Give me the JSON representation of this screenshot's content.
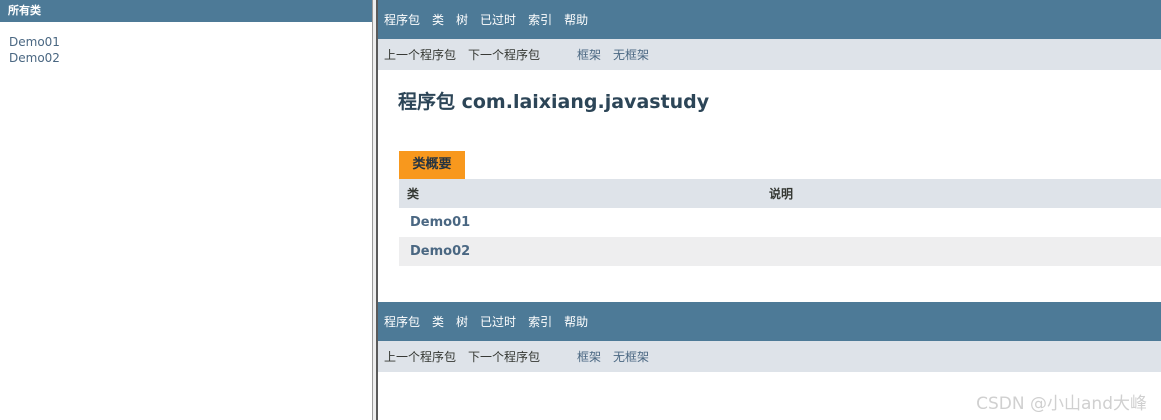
{
  "left_frame": {
    "header": "所有类",
    "classes": [
      "Demo01",
      "Demo02"
    ]
  },
  "top_nav": {
    "items": [
      "程序包",
      "类",
      "树",
      "已过时",
      "索引",
      "帮助"
    ]
  },
  "sub_nav": {
    "prev_package": "上一个程序包",
    "next_package": "下一个程序包",
    "frames": "框架",
    "no_frames": "无框架"
  },
  "page": {
    "title": "程序包 com.laixiang.javastudy",
    "summary_tab": "类概要",
    "table": {
      "headers": [
        "类",
        "说明"
      ],
      "rows": [
        {
          "class": "Demo01",
          "description": ""
        },
        {
          "class": "Demo02",
          "description": ""
        }
      ]
    }
  },
  "bottom_nav": {
    "items": [
      "程序包",
      "类",
      "树",
      "已过时",
      "索引",
      "帮助"
    ],
    "prev_package": "上一个程序包",
    "next_package": "下一个程序包",
    "frames": "框架",
    "no_frames": "无框架"
  },
  "watermark": "CSDN @小山and大峰",
  "colors": {
    "nav_bar": "#4d7a97",
    "sub_nav": "#dee3e9",
    "tab": "#f8981d",
    "link": "#4a6782",
    "row_alt": "#eeeeef"
  }
}
